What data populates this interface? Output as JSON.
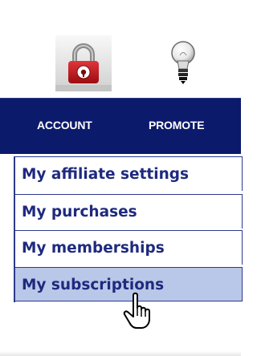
{
  "nav": {
    "items": [
      {
        "label": "ACCOUNT",
        "icon": "lock-icon"
      },
      {
        "label": "PROMOTE",
        "icon": "lightbulb-icon"
      }
    ]
  },
  "dropdown": {
    "items": [
      {
        "label": "My affiliate settings",
        "active": false
      },
      {
        "label": "My purchases",
        "active": false
      },
      {
        "label": "My memberships",
        "active": false
      },
      {
        "label": "My subscriptions",
        "active": true
      }
    ]
  },
  "colors": {
    "navbar_bg": "#0c1a6b",
    "nav_text": "#ffffff",
    "menu_text": "#1e2a7e",
    "menu_border": "#2d3a8c",
    "menu_active_bg": "#b9c7e8",
    "lock_red": "#c0141a"
  },
  "cursor": {
    "icon": "hand-pointer-icon"
  }
}
